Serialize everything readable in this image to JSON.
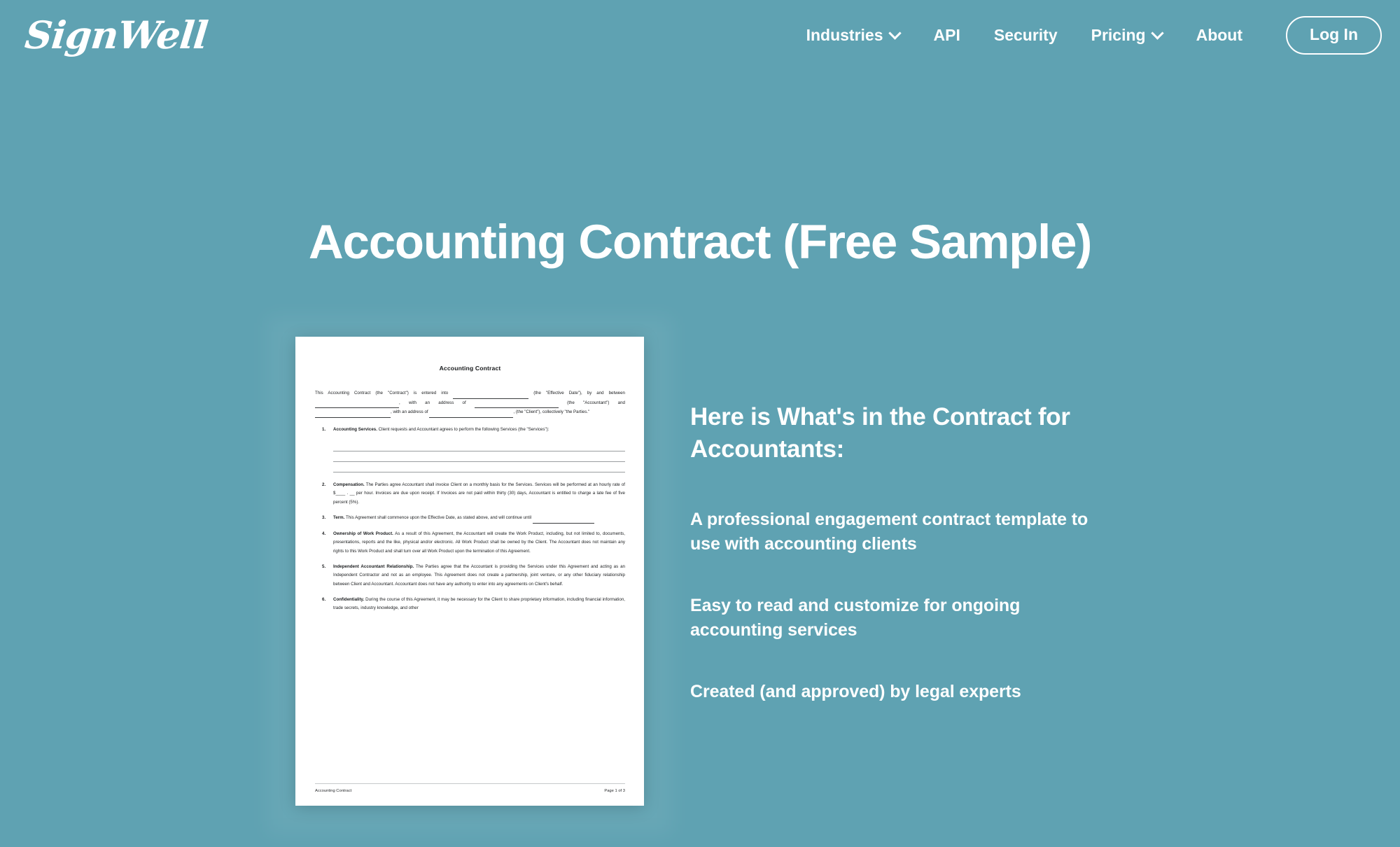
{
  "brand": {
    "name": "SignWell"
  },
  "nav": {
    "items": [
      {
        "label": "Industries",
        "has_chevron": true,
        "icon": "chevron-down-icon"
      },
      {
        "label": "API",
        "has_chevron": false,
        "icon": ""
      },
      {
        "label": "Security",
        "has_chevron": false,
        "icon": ""
      },
      {
        "label": "Pricing",
        "has_chevron": true,
        "icon": "chevron-down-icon"
      },
      {
        "label": "About",
        "has_chevron": false,
        "icon": ""
      }
    ],
    "login_label": "Log In"
  },
  "hero": {
    "title": "Accounting Contract (Free Sample)"
  },
  "copy": {
    "heading": "Here is What's in the Contract for Accountants:",
    "points": [
      "A professional engagement contract template to use with accounting clients",
      "Easy to read and customize for ongoing accounting services",
      "Created (and approved) by legal experts"
    ]
  },
  "document_preview": {
    "title": "Accounting Contract",
    "intro_before_1": "This Accounting Contract (the \"Contract\") is entered into ",
    "intro_after_1": " (the \"Effective Date\"), by and between ",
    "intro_after_2": ", with an address of ",
    "intro_after_3": " (the \"Accountant\") and ",
    "intro_after_4": ", with an address of ",
    "intro_after_5": ", (the \"Client\"), collectively \"the Parties.\"",
    "clauses": [
      {
        "number": "1.",
        "heading": "Accounting Services.",
        "body": " Client requests and Accountant agrees to perform the following Services (the \"Services\"):",
        "rule_lines": 3
      },
      {
        "number": "2.",
        "heading": "Compensation.",
        "body": " The Parties agree Accountant shall invoice Client on a monthly basis for the Services. Services will be performed at an hourly rate of $____ . __ per hour. Invoices are due upon receipt. If Invoices are not paid within thirty (30) days, Accountant is entitled to charge a late fee of five percent (5%).",
        "rule_lines": 0
      },
      {
        "number": "3.",
        "heading": "Term.",
        "body": " This Agreement shall commence upon the Effective Date, as stated above, and will continue until ",
        "short_rule": true,
        "rule_lines": 0
      },
      {
        "number": "4.",
        "heading": "Ownership of Work Product.",
        "body": " As a result of this Agreement, the Accountant will create the Work Product, including, but not limited to, documents, presentations, reports and the like, physical and/or electronic. All Work Product shall be owned by the Client. The Accountant does not maintain any rights to this Work Product and shall turn over all Work Product upon the termination of this Agreement.",
        "rule_lines": 0
      },
      {
        "number": "5.",
        "heading": "Independent Accountant Relationship.",
        "body": " The Parties agree that the Accountant is providing the Services under this Agreement and acting as an Independent Contractor and not as an employee. This Agreement does not create a partnership, joint venture, or any other fiduciary relationship between Client and Accountant. Accountant does not have any authority to enter into any agreements on Client's behalf.",
        "rule_lines": 0
      },
      {
        "number": "6.",
        "heading": "Confidentiality.",
        "body": " During the course of this Agreement, it may be necessary for the Client to share proprietary information, including financial information, trade secrets, industry knowledge, and other",
        "rule_lines": 0
      }
    ],
    "footer_left": "Accounting Contract",
    "footer_right": "Page 1 of 3"
  },
  "colors": {
    "background_teal": "#5FA2B2",
    "text_white": "#FFFFFF",
    "document_paper": "#FFFFFF",
    "document_text": "#1B1D1F"
  }
}
